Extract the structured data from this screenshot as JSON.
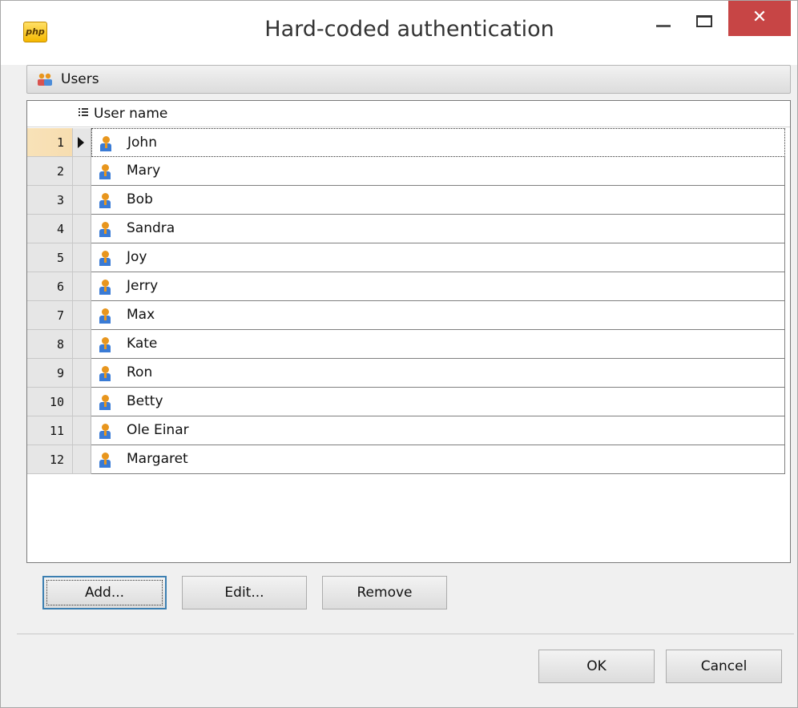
{
  "window": {
    "title": "Hard-coded authentication",
    "app_icon_text": "php",
    "close_symbol": "✕"
  },
  "group": {
    "label": "Users",
    "icon": "users-icon"
  },
  "grid": {
    "column_header": "User name",
    "current_row": 1,
    "rows": [
      {
        "num": "1",
        "name": "John"
      },
      {
        "num": "2",
        "name": "Mary"
      },
      {
        "num": "3",
        "name": "Bob"
      },
      {
        "num": "4",
        "name": "Sandra"
      },
      {
        "num": "5",
        "name": "Joy"
      },
      {
        "num": "6",
        "name": "Jerry"
      },
      {
        "num": "7",
        "name": "Max"
      },
      {
        "num": "8",
        "name": "Kate"
      },
      {
        "num": "9",
        "name": "Ron"
      },
      {
        "num": "10",
        "name": "Betty"
      },
      {
        "num": "11",
        "name": "Ole Einar"
      },
      {
        "num": "12",
        "name": "Margaret"
      }
    ]
  },
  "actions": {
    "add": "Add...",
    "edit": "Edit...",
    "remove": "Remove"
  },
  "dialog": {
    "ok": "OK",
    "cancel": "Cancel"
  },
  "colors": {
    "close_button": "#c74545",
    "current_row_number": "#f8e2b8",
    "default_button_border": "#3c7fb1"
  }
}
